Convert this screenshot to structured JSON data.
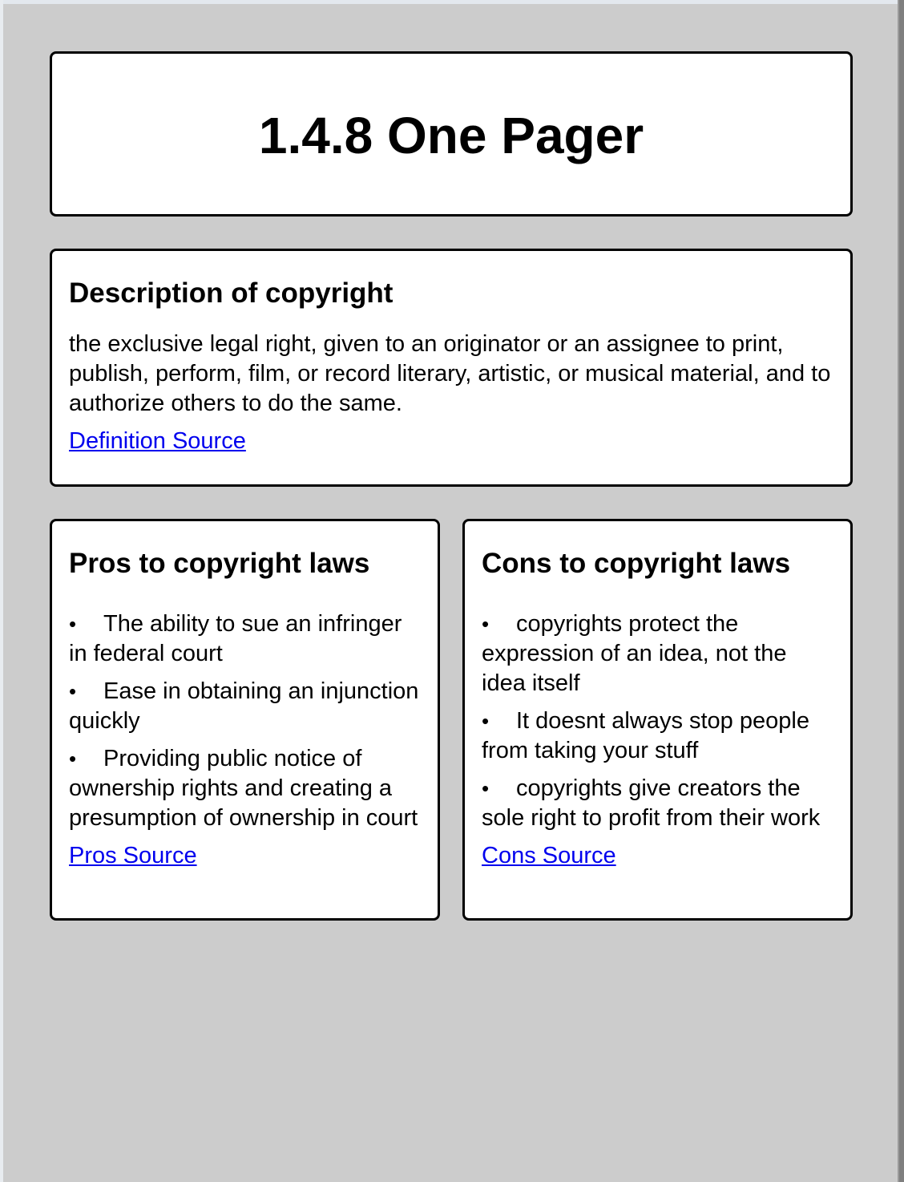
{
  "page": {
    "title": "1.4.8 One Pager"
  },
  "description": {
    "heading": "Description of copyright",
    "text": "the exclusive legal right, given to an originator or an assignee to print, publish, perform, film, or record literary, artistic, or musical material, and to authorize others to do the same.",
    "link_label": "Definition Source"
  },
  "pros": {
    "heading": "Pros to copyright laws",
    "items": [
      "The ability to sue an infringer in federal court",
      "Ease in obtaining an injunction quickly",
      "Providing public notice of ownership rights and creating a presumption of ownership in court"
    ],
    "link_label": "Pros Source"
  },
  "cons": {
    "heading": "Cons to copyright laws",
    "items": [
      "copyrights protect the expression of an idea, not the idea itself",
      "It doesnt always stop people from taking your stuff",
      "copyrights give creators the sole right to profit from their work"
    ],
    "link_label": "Cons Source"
  },
  "colors": {
    "background": "#cccccc",
    "card": "#ffffff",
    "border": "#000000",
    "link": "#0000ee"
  }
}
